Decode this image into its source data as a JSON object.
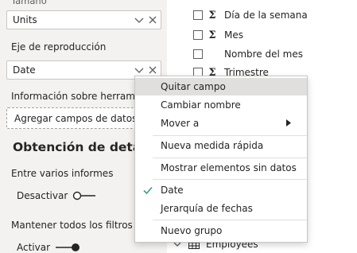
{
  "left": {
    "cut_label": "Tamaño",
    "units_well": "Units",
    "playback_axis_label": "Eje de reproducción",
    "date_well": "Date",
    "tooltip_label": "Información sobre herramientas",
    "drop_zone_text": "Agregar campos de datos aquí",
    "drillthrough_heading": "Obtención de detalles",
    "cross_report_label": "Entre varios informes",
    "cross_report_state": "Desactivar",
    "keep_filters_label": "Mantener todos los filtros",
    "keep_filters_state": "Activar"
  },
  "fields": {
    "items": [
      {
        "name": "Día de la semana",
        "sigma": "Σ"
      },
      {
        "name": "Mes",
        "sigma": "Σ"
      },
      {
        "name": "Nombre del mes",
        "sigma": ""
      },
      {
        "name": "Trimestre",
        "sigma": "Σ"
      }
    ],
    "table_name": "Employees"
  },
  "menu": {
    "remove_field": "Quitar campo",
    "rename": "Cambiar nombre",
    "move_to": "Mover a",
    "new_quick_measure": "Nueva medida rápida",
    "show_items_no_data": "Mostrar elementos sin datos",
    "date": "Date",
    "date_hierarchy": "Jerarquía de fechas",
    "new_group": "Nuevo grupo"
  },
  "colors": {
    "pane_bg": "#f3f2f1",
    "accent_check": "#3a9d8f",
    "menu_hover": "#e1dfdd"
  },
  "icons": {
    "chevron": "chevron-down-icon",
    "close": "close-icon",
    "check": "checkmark-icon",
    "submenu": "submenu-arrow-icon",
    "table": "table-icon"
  }
}
